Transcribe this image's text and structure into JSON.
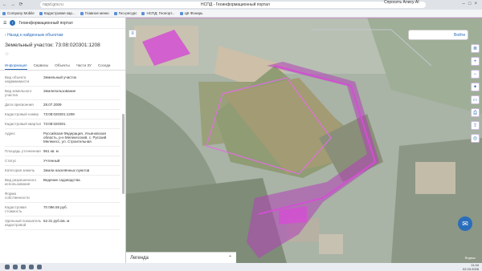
{
  "browser": {
    "domain": "nspd.gov.ru",
    "page_title": "НСПД - Геоинформационный портал",
    "assistant_label": "Спросить Алису AI"
  },
  "bookmarks": [
    {
      "label": "Company Mobile"
    },
    {
      "label": "Кадастровая кар..."
    },
    {
      "label": "Главное меню"
    },
    {
      "label": "Гео-ресурс"
    },
    {
      "label": "НСПД: Геопорт..."
    },
    {
      "label": "ЦК Фонарь"
    }
  ],
  "panel": {
    "header": "Геоинформационный портал",
    "back_link": "Назад к найденным объектам",
    "title": "Земельный участок: 73:08:020301:1208",
    "tabs": [
      {
        "label": "Информация"
      },
      {
        "label": "Сервисы"
      },
      {
        "label": "Объекты"
      },
      {
        "label": "Части ЗУ"
      },
      {
        "label": "Соседи"
      }
    ],
    "rows": [
      {
        "key": "Вид объекта недвижимости",
        "value": "Земельный участок"
      },
      {
        "key": "Вид земельного участка",
        "value": "Землепользование"
      },
      {
        "key": "Дата присвоения",
        "value": "28.07.2009"
      },
      {
        "key": "Кадастровый номер",
        "value": "73:08:020301:1208"
      },
      {
        "key": "Кадастровый квартал",
        "value": "73:08:020301"
      },
      {
        "key": "Адрес",
        "value": "Российская Федерация, Ульяновская область, р-н Мелекесский, с. Русский Мелекесс, ул. Строительная"
      },
      {
        "key": "Площадь уточненная",
        "value": "961 кв. м"
      },
      {
        "key": "Статус",
        "value": "Учтенный"
      },
      {
        "key": "Категория земель",
        "value": "Земли населённых пунктов"
      },
      {
        "key": "Вид разрешенного использования",
        "value": "Ведение садоводства"
      },
      {
        "key": "Форма собственности",
        "value": ""
      },
      {
        "key": "Кадастровая стоимость",
        "value": "70 096.55 руб."
      },
      {
        "key": "Удельный показатель кадастровой",
        "value": "52.31 руб./кв. м"
      }
    ]
  },
  "map": {
    "search_label": "Войти",
    "legend_label": "Легенда",
    "scale_text": "Яндекс",
    "tool_icons": [
      "layers-icon",
      "plus-icon",
      "minus-icon",
      "compass-icon",
      "ruler-icon",
      "print-icon",
      "share-icon",
      "globe-icon"
    ]
  },
  "taskbar": {
    "time": "11:44",
    "date": "02.03.2026"
  }
}
